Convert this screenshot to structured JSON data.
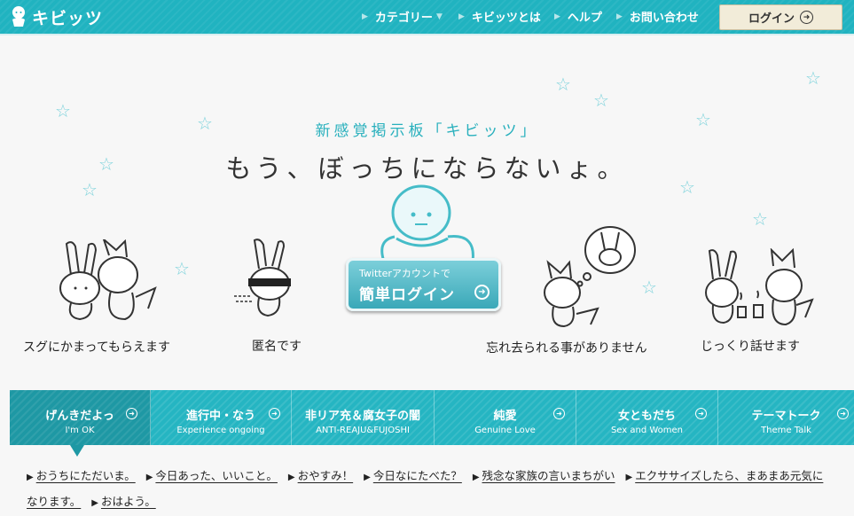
{
  "header": {
    "logo_text": "キビッツ",
    "nav": [
      {
        "label": "カテゴリー",
        "has_dropdown": true
      },
      {
        "label": "キビッツとは"
      },
      {
        "label": "ヘルプ"
      },
      {
        "label": "お問い合わせ"
      }
    ],
    "login_label": "ログイン"
  },
  "hero": {
    "tagline": "新感覚掲示板「キビッツ」",
    "headline": "もう、ぼっちにならないょ。",
    "features": [
      "スグにかまってもらえます",
      "匿名です",
      "忘れ去られる事がありません",
      "じっくり話せます"
    ],
    "twitter_button": {
      "line1": "Twitterアカウントで",
      "line2": "簡単ログイン"
    }
  },
  "tabs": [
    {
      "jp": "げんきだよっ",
      "en": "I'm OK",
      "active": true
    },
    {
      "jp": "進行中・なう",
      "en": "Experience ongoing",
      "active": false
    },
    {
      "jp": "非リア充＆腐女子の闇",
      "en": "ANTI-REAJU&FUJOSHI",
      "active": false
    },
    {
      "jp": "純愛",
      "en": "Genuine Love",
      "active": false
    },
    {
      "jp": "女ともだち",
      "en": "Sex and Women",
      "active": false
    },
    {
      "jp": "テーマトーク",
      "en": "Theme Talk",
      "active": false
    }
  ],
  "threads": [
    "おうちにただいま。",
    "今日あった、いいこと。",
    "おやすみ！",
    "今日なにたべた？",
    "残念な家族の言いまちがい",
    "エクササイズしたら、まあまあ元気になります。",
    "おはよう。"
  ],
  "colors": {
    "brand": "#20b3c0",
    "brand_dark": "#1e98a4",
    "star": "#7fd3dc"
  },
  "icons": {
    "logo": "mascot-icon",
    "dropdown": "chevron-down-icon",
    "arrow": "circle-arrow-right-icon",
    "decoration": "star-icon"
  }
}
